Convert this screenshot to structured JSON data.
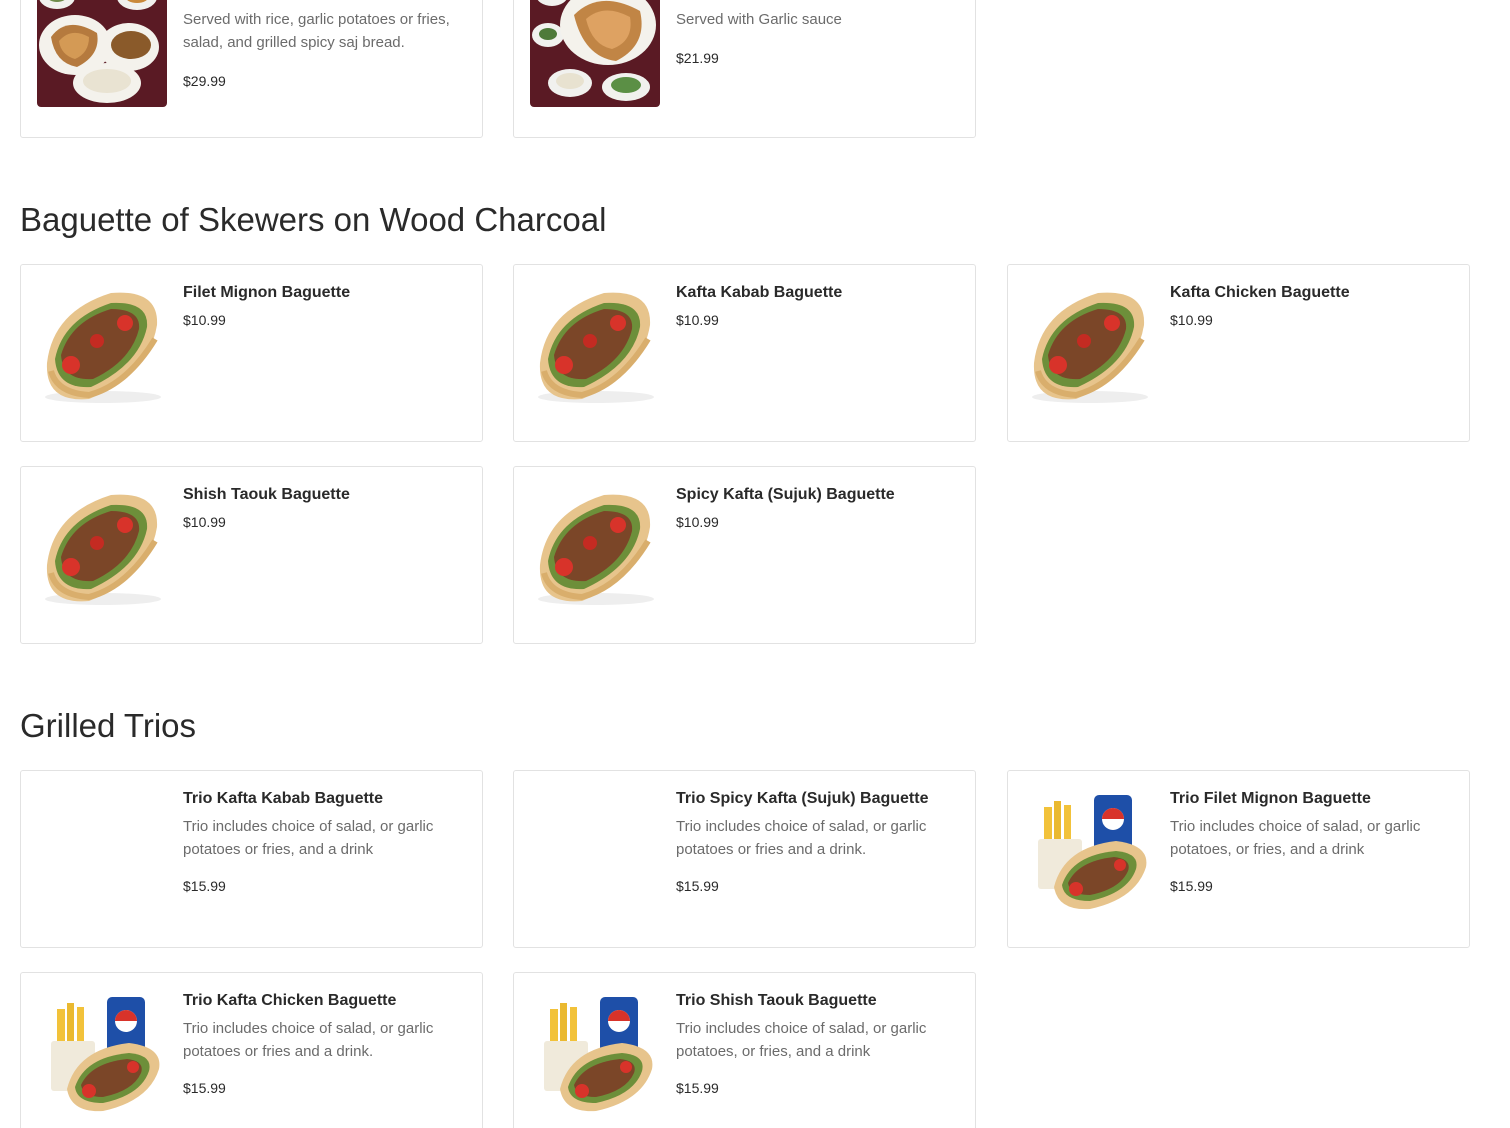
{
  "top_items": [
    {
      "desc": "Served with rice, garlic potatoes or fries, salad, and grilled spicy saj bread.",
      "price": "$29.99"
    },
    {
      "desc": "Served with Garlic sauce",
      "price": "$21.99"
    }
  ],
  "baguette_section": {
    "title": "Baguette of Skewers on Wood Charcoal",
    "items": [
      {
        "name": "Filet Mignon Baguette",
        "price": "$10.99"
      },
      {
        "name": "Kafta Kabab Baguette",
        "price": "$10.99"
      },
      {
        "name": "Kafta Chicken Baguette",
        "price": "$10.99"
      },
      {
        "name": "Shish Taouk Baguette",
        "price": "$10.99"
      },
      {
        "name": "Spicy Kafta (Sujuk) Baguette",
        "price": "$10.99"
      }
    ]
  },
  "trios_section": {
    "title": "Grilled Trios",
    "items": [
      {
        "name": "Trio Kafta Kabab Baguette",
        "desc": "Trio includes choice of salad, or garlic potatoes or fries, and a drink",
        "price": "$15.99"
      },
      {
        "name": "Trio Spicy Kafta (Sujuk) Baguette",
        "desc": "Trio includes choice of salad, or garlic potatoes or fries and a drink.",
        "price": "$15.99"
      },
      {
        "name": "Trio Filet Mignon Baguette",
        "desc": "Trio includes choice of salad, or garlic potatoes, or fries, and a drink",
        "price": "$15.99"
      },
      {
        "name": "Trio Kafta Chicken Baguette",
        "desc": "Trio includes choice of salad, or garlic potatoes or fries and a drink.",
        "price": "$15.99"
      },
      {
        "name": "Trio Shish Taouk Baguette",
        "desc": "Trio includes choice of salad, or garlic potatoes, or fries, and a drink",
        "price": "$15.99"
      }
    ]
  }
}
